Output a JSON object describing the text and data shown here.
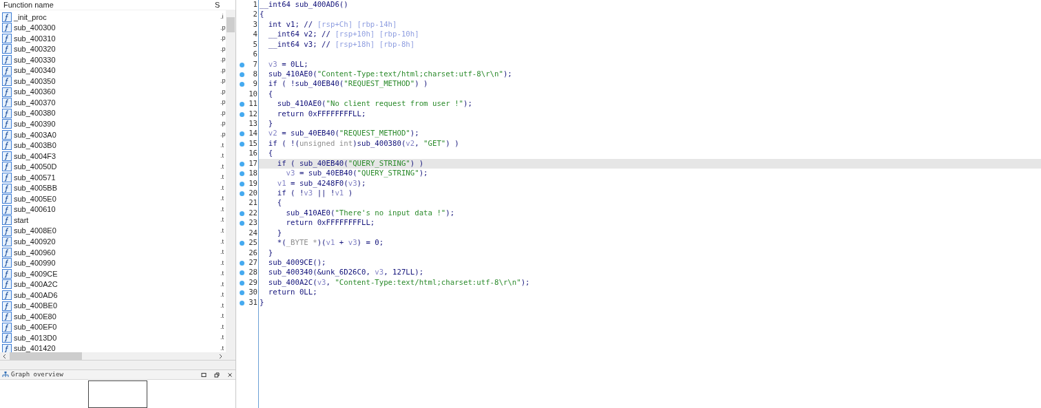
{
  "functions": {
    "columns": [
      "Function name",
      "S"
    ],
    "rows": [
      {
        "name": "_init_proc",
        "segment": ".i"
      },
      {
        "name": "sub_400300",
        "segment": ".p"
      },
      {
        "name": "sub_400310",
        "segment": ".p"
      },
      {
        "name": "sub_400320",
        "segment": ".p"
      },
      {
        "name": "sub_400330",
        "segment": ".p"
      },
      {
        "name": "sub_400340",
        "segment": ".p"
      },
      {
        "name": "sub_400350",
        "segment": ".p"
      },
      {
        "name": "sub_400360",
        "segment": ".p"
      },
      {
        "name": "sub_400370",
        "segment": ".p"
      },
      {
        "name": "sub_400380",
        "segment": ".p"
      },
      {
        "name": "sub_400390",
        "segment": ".p"
      },
      {
        "name": "sub_4003A0",
        "segment": ".p"
      },
      {
        "name": "sub_4003B0",
        "segment": ".t"
      },
      {
        "name": "sub_4004F3",
        "segment": ".t"
      },
      {
        "name": "sub_40050D",
        "segment": ".t"
      },
      {
        "name": "sub_400571",
        "segment": ".t"
      },
      {
        "name": "sub_4005BB",
        "segment": ".t"
      },
      {
        "name": "sub_4005E0",
        "segment": ".t"
      },
      {
        "name": "sub_400610",
        "segment": ".t"
      },
      {
        "name": "start",
        "segment": ".t"
      },
      {
        "name": "sub_4008E0",
        "segment": ".t"
      },
      {
        "name": "sub_400920",
        "segment": ".t"
      },
      {
        "name": "sub_400960",
        "segment": ".t"
      },
      {
        "name": "sub_400990",
        "segment": ".t"
      },
      {
        "name": "sub_4009CE",
        "segment": ".t"
      },
      {
        "name": "sub_400A2C",
        "segment": ".t"
      },
      {
        "name": "sub_400AD6",
        "segment": ".t"
      },
      {
        "name": "sub_400BE0",
        "segment": ".t"
      },
      {
        "name": "sub_400E80",
        "segment": ".t"
      },
      {
        "name": "sub_400EF0",
        "segment": ".t"
      },
      {
        "name": "sub_4013D0",
        "segment": ".t"
      },
      {
        "name": "sub_401420",
        "segment": ".t"
      }
    ]
  },
  "graph_overview": {
    "title": "Graph overview"
  },
  "code": [
    {
      "number": "1",
      "breakpoint": false,
      "highlighted": false,
      "tokens": [
        {
          "kind": "plain",
          "text": "__int64 sub_400AD6()"
        }
      ]
    },
    {
      "number": "2",
      "breakpoint": false,
      "highlighted": false,
      "tokens": [
        {
          "kind": "plain",
          "text": "{"
        }
      ]
    },
    {
      "number": "3",
      "breakpoint": false,
      "highlighted": false,
      "tokens": [
        {
          "kind": "plain",
          "text": "  int v1; // "
        },
        {
          "kind": "comment",
          "text": "[rsp+Ch] [rbp-14h]"
        }
      ]
    },
    {
      "number": "4",
      "breakpoint": false,
      "highlighted": false,
      "tokens": [
        {
          "kind": "plain",
          "text": "  __int64 v2; // "
        },
        {
          "kind": "comment",
          "text": "[rsp+10h] [rbp-10h]"
        }
      ]
    },
    {
      "number": "5",
      "breakpoint": false,
      "highlighted": false,
      "tokens": [
        {
          "kind": "plain",
          "text": "  __int64 v3; // "
        },
        {
          "kind": "comment",
          "text": "[rsp+18h] [rbp-8h]"
        }
      ]
    },
    {
      "number": "6",
      "breakpoint": false,
      "highlighted": false
    },
    {
      "number": "7",
      "breakpoint": true,
      "highlighted": false,
      "tokens": [
        {
          "kind": "var",
          "text": "  v3"
        },
        {
          "kind": "plain",
          "text": " = 0LL;"
        }
      ]
    },
    {
      "number": "8",
      "breakpoint": true,
      "highlighted": false,
      "tokens": [
        {
          "kind": "plain",
          "text": "  sub_410AE0("
        },
        {
          "kind": "string",
          "text": "\"Content-Type:text/html;charset:utf-8\\r\\n\""
        },
        {
          "kind": "plain",
          "text": ");"
        }
      ]
    },
    {
      "number": "9",
      "breakpoint": true,
      "highlighted": false,
      "tokens": [
        {
          "kind": "plain",
          "text": "  if ( !sub_40EB40("
        },
        {
          "kind": "string",
          "text": "\"REQUEST_METHOD\""
        },
        {
          "kind": "plain",
          "text": ") )"
        }
      ]
    },
    {
      "number": "10",
      "breakpoint": false,
      "highlighted": false,
      "tokens": [
        {
          "kind": "plain",
          "text": "  {"
        }
      ]
    },
    {
      "number": "11",
      "breakpoint": true,
      "highlighted": false,
      "tokens": [
        {
          "kind": "plain",
          "text": "    sub_410AE0("
        },
        {
          "kind": "string",
          "text": "\"No client request from user !\""
        },
        {
          "kind": "plain",
          "text": ");"
        }
      ]
    },
    {
      "number": "12",
      "breakpoint": true,
      "highlighted": false,
      "tokens": [
        {
          "kind": "plain",
          "text": "    return 0xFFFFFFFFLL;"
        }
      ]
    },
    {
      "number": "13",
      "breakpoint": false,
      "highlighted": false,
      "tokens": [
        {
          "kind": "plain",
          "text": "  }"
        }
      ]
    },
    {
      "number": "14",
      "breakpoint": true,
      "highlighted": false,
      "tokens": [
        {
          "kind": "var",
          "text": "  v2"
        },
        {
          "kind": "plain",
          "text": " = sub_40EB40("
        },
        {
          "kind": "string",
          "text": "\"REQUEST_METHOD\""
        },
        {
          "kind": "plain",
          "text": ");"
        }
      ]
    },
    {
      "number": "15",
      "breakpoint": true,
      "highlighted": false,
      "tokens": [
        {
          "kind": "plain",
          "text": "  if ( !("
        },
        {
          "kind": "type",
          "text": "unsigned int"
        },
        {
          "kind": "plain",
          "text": ")sub_400380("
        },
        {
          "kind": "var",
          "text": "v2"
        },
        {
          "kind": "plain",
          "text": ", "
        },
        {
          "kind": "string",
          "text": "\"GET\""
        },
        {
          "kind": "plain",
          "text": ") )"
        }
      ]
    },
    {
      "number": "16",
      "breakpoint": false,
      "highlighted": false,
      "tokens": [
        {
          "kind": "plain",
          "text": "  {"
        }
      ]
    },
    {
      "number": "17",
      "breakpoint": true,
      "highlighted": true,
      "tokens": [
        {
          "kind": "plain",
          "text": "    if ( sub_40EB40("
        },
        {
          "kind": "string",
          "text": "\"QUERY_STRING\""
        },
        {
          "kind": "plain",
          "text": ") )"
        }
      ]
    },
    {
      "number": "18",
      "breakpoint": true,
      "highlighted": false,
      "tokens": [
        {
          "kind": "var",
          "text": "      v3"
        },
        {
          "kind": "plain",
          "text": " = sub_40EB40("
        },
        {
          "kind": "string",
          "text": "\"QUERY_STRING\""
        },
        {
          "kind": "plain",
          "text": ");"
        }
      ]
    },
    {
      "number": "19",
      "breakpoint": true,
      "highlighted": false,
      "tokens": [
        {
          "kind": "var",
          "text": "    v1"
        },
        {
          "kind": "plain",
          "text": " = sub_4248F0("
        },
        {
          "kind": "var",
          "text": "v3"
        },
        {
          "kind": "plain",
          "text": ");"
        }
      ]
    },
    {
      "number": "20",
      "breakpoint": true,
      "highlighted": false,
      "tokens": [
        {
          "kind": "plain",
          "text": "    if ( !"
        },
        {
          "kind": "var",
          "text": "v3"
        },
        {
          "kind": "plain",
          "text": " || !"
        },
        {
          "kind": "var",
          "text": "v1"
        },
        {
          "kind": "plain",
          "text": " )"
        }
      ]
    },
    {
      "number": "21",
      "breakpoint": false,
      "highlighted": false,
      "tokens": [
        {
          "kind": "plain",
          "text": "    {"
        }
      ]
    },
    {
      "number": "22",
      "breakpoint": true,
      "highlighted": false,
      "tokens": [
        {
          "kind": "plain",
          "text": "      sub_410AE0("
        },
        {
          "kind": "string",
          "text": "\"There's no input data !\""
        },
        {
          "kind": "plain",
          "text": ");"
        }
      ]
    },
    {
      "number": "23",
      "breakpoint": true,
      "highlighted": false,
      "tokens": [
        {
          "kind": "plain",
          "text": "      return 0xFFFFFFFFLL;"
        }
      ]
    },
    {
      "number": "24",
      "breakpoint": false,
      "highlighted": false,
      "tokens": [
        {
          "kind": "plain",
          "text": "    }"
        }
      ]
    },
    {
      "number": "25",
      "breakpoint": true,
      "highlighted": false,
      "tokens": [
        {
          "kind": "plain",
          "text": "    *("
        },
        {
          "kind": "type",
          "text": "_BYTE *"
        },
        {
          "kind": "plain",
          "text": ")("
        },
        {
          "kind": "var",
          "text": "v1"
        },
        {
          "kind": "plain",
          "text": " + "
        },
        {
          "kind": "var",
          "text": "v3"
        },
        {
          "kind": "plain",
          "text": ") = 0;"
        }
      ]
    },
    {
      "number": "26",
      "breakpoint": false,
      "highlighted": false,
      "tokens": [
        {
          "kind": "plain",
          "text": "  }"
        }
      ]
    },
    {
      "number": "27",
      "breakpoint": true,
      "highlighted": false,
      "tokens": [
        {
          "kind": "plain",
          "text": "  sub_4009CE();"
        }
      ]
    },
    {
      "number": "28",
      "breakpoint": true,
      "highlighted": false,
      "tokens": [
        {
          "kind": "plain",
          "text": "  sub_400340(&unk_6D26C0, "
        },
        {
          "kind": "var",
          "text": "v3"
        },
        {
          "kind": "plain",
          "text": ", 127LL);"
        }
      ]
    },
    {
      "number": "29",
      "breakpoint": true,
      "highlighted": false,
      "tokens": [
        {
          "kind": "plain",
          "text": "  sub_400A2C("
        },
        {
          "kind": "var",
          "text": "v3"
        },
        {
          "kind": "plain",
          "text": ", "
        },
        {
          "kind": "string",
          "text": "\"Content-Type:text/html;charset:utf-8\\r\\n\""
        },
        {
          "kind": "plain",
          "text": ");"
        }
      ]
    },
    {
      "number": "30",
      "breakpoint": true,
      "highlighted": false,
      "tokens": [
        {
          "kind": "plain",
          "text": "  return 0LL;"
        }
      ]
    },
    {
      "number": "31",
      "breakpoint": true,
      "highlighted": false,
      "tokens": [
        {
          "kind": "plain",
          "text": "}"
        }
      ]
    }
  ]
}
